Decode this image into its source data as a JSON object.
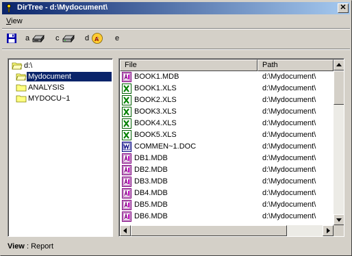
{
  "window": {
    "title": "DirTree - d:\\Mydocument\\"
  },
  "menu": {
    "items": [
      "View"
    ]
  },
  "toolbar": {
    "drives": [
      {
        "letter": "a",
        "icon": "floppy-drive-icon"
      },
      {
        "letter": "c",
        "icon": "hard-drive-icon"
      },
      {
        "letter": "d",
        "icon": "cd-drive-icon"
      },
      {
        "letter": "e",
        "icon": ""
      }
    ]
  },
  "tree": {
    "nodes": [
      {
        "label": "d:\\",
        "selected": false,
        "icon": "open-folder-icon"
      },
      {
        "label": "Mydocument",
        "selected": true,
        "icon": "open-folder-icon"
      },
      {
        "label": "ANALYSIS",
        "selected": false,
        "icon": "folder-icon"
      },
      {
        "label": "MYDOCU~1",
        "selected": false,
        "icon": "folder-icon"
      }
    ]
  },
  "list": {
    "columns": [
      "File",
      "Path"
    ],
    "rows": [
      {
        "name": "BOOK1.MDB",
        "path": "d:\\Mydocument\\",
        "type": "mdb"
      },
      {
        "name": "BOOK1.XLS",
        "path": "d:\\Mydocument\\",
        "type": "xls"
      },
      {
        "name": "BOOK2.XLS",
        "path": "d:\\Mydocument\\",
        "type": "xls"
      },
      {
        "name": "BOOK3.XLS",
        "path": "d:\\Mydocument\\",
        "type": "xls"
      },
      {
        "name": "BOOK4.XLS",
        "path": "d:\\Mydocument\\",
        "type": "xls"
      },
      {
        "name": "BOOK5.XLS",
        "path": "d:\\Mydocument\\",
        "type": "xls"
      },
      {
        "name": "COMMEN~1.DOC",
        "path": "d:\\Mydocument\\",
        "type": "doc"
      },
      {
        "name": "DB1.MDB",
        "path": "d:\\Mydocument\\",
        "type": "mdb"
      },
      {
        "name": "DB2.MDB",
        "path": "d:\\Mydocument\\",
        "type": "mdb"
      },
      {
        "name": "DB3.MDB",
        "path": "d:\\Mydocument\\",
        "type": "mdb"
      },
      {
        "name": "DB4.MDB",
        "path": "d:\\Mydocument\\",
        "type": "mdb"
      },
      {
        "name": "DB5.MDB",
        "path": "d:\\Mydocument\\",
        "type": "mdb"
      },
      {
        "name": "DB6.MDB",
        "path": "d:\\Mydocument\\",
        "type": "mdb"
      }
    ]
  },
  "status": {
    "label": "View",
    "separator": ":",
    "value": "Report"
  },
  "colors": {
    "titlebar_start": "#0a246a",
    "titlebar_end": "#a6caf0",
    "selection": "#0a246a",
    "face": "#d4d0c8"
  }
}
